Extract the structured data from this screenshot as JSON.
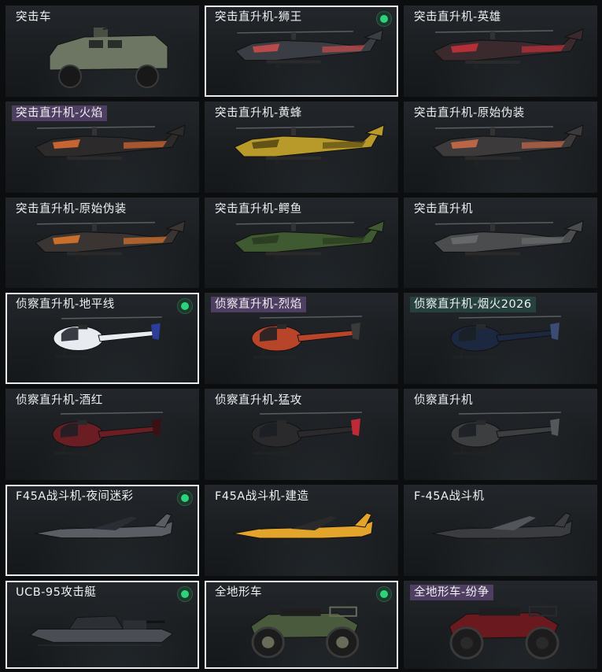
{
  "cards": [
    {
      "label": "突击车",
      "kind": "armored-car",
      "tier": "plain",
      "selected": false,
      "badge": false,
      "color": "#6d7563",
      "accent": "#4a4f44"
    },
    {
      "label": "突击直升机-狮王",
      "kind": "attack-heli",
      "tier": "plain",
      "selected": true,
      "badge": true,
      "color": "#3a3e44",
      "accent": "#c94a4a"
    },
    {
      "label": "突击直升机-英雄",
      "kind": "attack-heli",
      "tier": "plain",
      "selected": false,
      "badge": false,
      "color": "#3a2a2e",
      "accent": "#c2303a"
    },
    {
      "label": "突击直升机-火焰",
      "kind": "attack-heli",
      "tier": "epic",
      "selected": false,
      "badge": false,
      "color": "#2c2a2a",
      "accent": "#d86a32"
    },
    {
      "label": "突击直升机-黄蜂",
      "kind": "attack-heli",
      "tier": "plain",
      "selected": false,
      "badge": false,
      "color": "#b79a2a",
      "accent": "#5a4a14"
    },
    {
      "label": "突击直升机-原始伪装",
      "kind": "attack-heli",
      "tier": "plain",
      "selected": false,
      "badge": false,
      "color": "#3c3a3a",
      "accent": "#c86a48"
    },
    {
      "label": "突击直升机-原始伪装",
      "kind": "attack-heli",
      "tier": "plain",
      "selected": false,
      "badge": false,
      "color": "#3a3433",
      "accent": "#d8752e"
    },
    {
      "label": "突击直升机-鳄鱼",
      "kind": "attack-heli",
      "tier": "plain",
      "selected": false,
      "badge": false,
      "color": "#3f5a30",
      "accent": "#2a3a20"
    },
    {
      "label": "突击直升机",
      "kind": "attack-heli",
      "tier": "plain",
      "selected": false,
      "badge": false,
      "color": "#4a4c4e",
      "accent": "#6a6c6e"
    },
    {
      "label": "侦察直升机-地平线",
      "kind": "scout-heli",
      "tier": "plain",
      "selected": true,
      "badge": true,
      "color": "#e8ecf0",
      "accent": "#2a3e9a"
    },
    {
      "label": "侦察直升机-烈焰",
      "kind": "scout-heli",
      "tier": "epic",
      "selected": false,
      "badge": false,
      "color": "#b8452a",
      "accent": "#3a3a3a"
    },
    {
      "label": "侦察直升机-烟火2026",
      "kind": "scout-heli",
      "tier": "rare",
      "selected": false,
      "badge": false,
      "color": "#1c2840",
      "accent": "#3a4c74"
    },
    {
      "label": "侦察直升机-酒红",
      "kind": "scout-heli",
      "tier": "plain",
      "selected": false,
      "badge": false,
      "color": "#6a1e24",
      "accent": "#3a1014"
    },
    {
      "label": "侦察直升机-猛攻",
      "kind": "scout-heli",
      "tier": "plain",
      "selected": false,
      "badge": false,
      "color": "#2a2a2c",
      "accent": "#c02a36"
    },
    {
      "label": "侦察直升机",
      "kind": "scout-heli",
      "tier": "plain",
      "selected": false,
      "badge": false,
      "color": "#3c3e40",
      "accent": "#55585a"
    },
    {
      "label": "F45A战斗机-夜间迷彩",
      "kind": "jet",
      "tier": "plain",
      "selected": true,
      "badge": true,
      "color": "#5a5e64",
      "accent": "#2a2e34"
    },
    {
      "label": "F45A战斗机-建造",
      "kind": "jet",
      "tier": "plain",
      "selected": false,
      "badge": false,
      "color": "#e2a42a",
      "accent": "#2a2a2a"
    },
    {
      "label": "F-45A战斗机",
      "kind": "jet",
      "tier": "plain",
      "selected": false,
      "badge": false,
      "color": "#3a3c40",
      "accent": "#52565a"
    },
    {
      "label": "UCB-95攻击艇",
      "kind": "boat",
      "tier": "plain",
      "selected": true,
      "badge": true,
      "color": "#4a4e54",
      "accent": "#2c3034"
    },
    {
      "label": "全地形车",
      "kind": "atv",
      "tier": "plain",
      "selected": true,
      "badge": true,
      "color": "#4a5a3c",
      "accent": "#6a6c5a"
    },
    {
      "label": "全地形车-纷争",
      "kind": "atv",
      "tier": "epic",
      "selected": false,
      "badge": false,
      "color": "#6a1a1e",
      "accent": "#2a2a2c"
    }
  ]
}
